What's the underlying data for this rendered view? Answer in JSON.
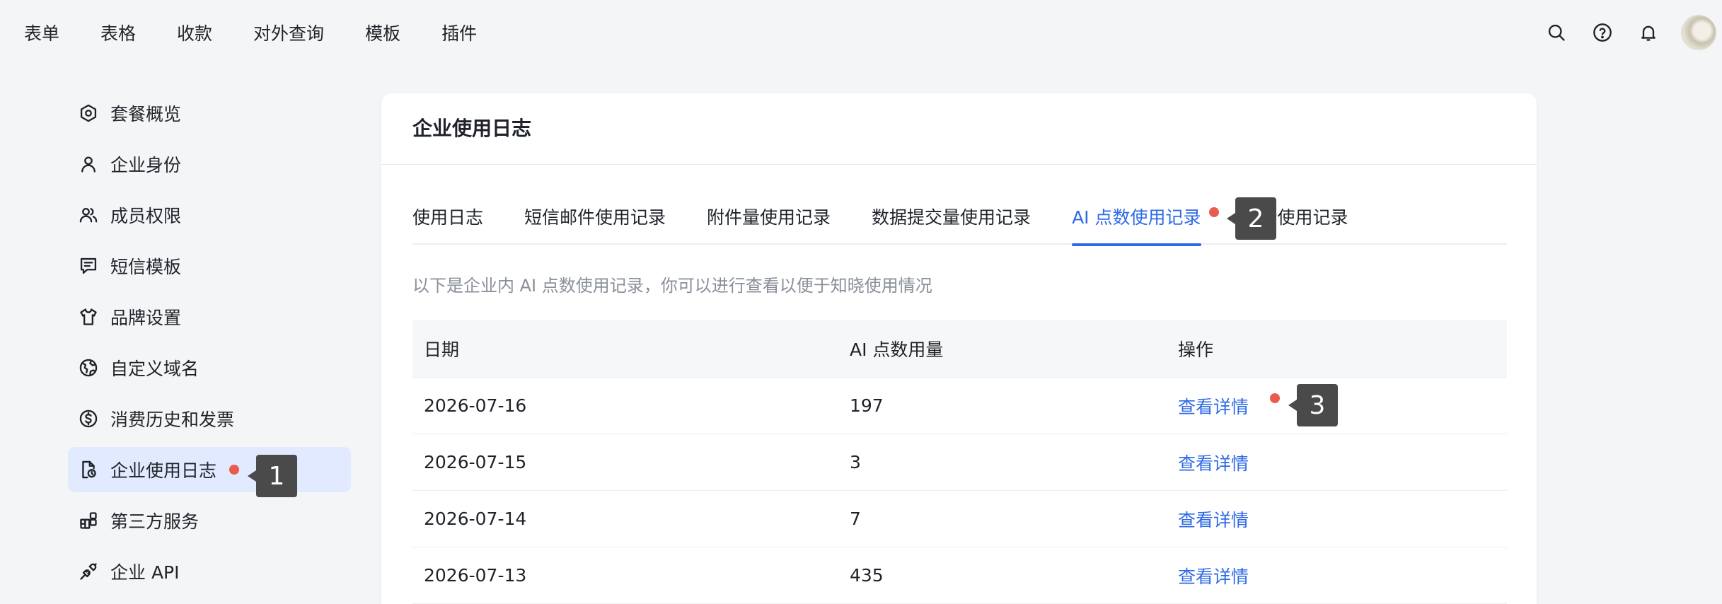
{
  "topnav": {
    "items": [
      "表单",
      "表格",
      "收款",
      "对外查询",
      "模板",
      "插件"
    ],
    "icons": [
      "search-icon",
      "help-icon",
      "bell-icon"
    ]
  },
  "sidebar": {
    "items": [
      {
        "label": "套餐概览",
        "icon": "package-icon"
      },
      {
        "label": "企业身份",
        "icon": "user-icon"
      },
      {
        "label": "成员权限",
        "icon": "users-icon"
      },
      {
        "label": "短信模板",
        "icon": "message-icon"
      },
      {
        "label": "品牌设置",
        "icon": "shirt-icon"
      },
      {
        "label": "自定义域名",
        "icon": "globe-icon"
      },
      {
        "label": "消费历史和发票",
        "icon": "dollar-icon"
      },
      {
        "label": "企业使用日志",
        "icon": "log-icon",
        "active": true
      },
      {
        "label": "第三方服务",
        "icon": "apps-icon"
      },
      {
        "label": "企业 API",
        "icon": "plug-icon"
      }
    ]
  },
  "main": {
    "title": "企业使用日志",
    "tabs": [
      "使用日志",
      "短信邮件使用记录",
      "附件量使用记录",
      "数据提交量使用记录",
      "AI 点数使用记录",
      "语音使用记录"
    ],
    "active_tab": 4,
    "description": "以下是企业内 AI 点数使用记录，你可以进行查看以便于知晓使用情况",
    "table": {
      "headers": [
        "日期",
        "AI 点数用量",
        "操作"
      ],
      "rows": [
        {
          "date": "2026-07-16",
          "amount": "197",
          "action": "查看详情"
        },
        {
          "date": "2026-07-15",
          "amount": "3",
          "action": "查看详情"
        },
        {
          "date": "2026-07-14",
          "amount": "7",
          "action": "查看详情"
        },
        {
          "date": "2026-07-13",
          "amount": "435",
          "action": "查看详情"
        }
      ]
    }
  },
  "annotations": [
    "1",
    "2",
    "3"
  ],
  "colors": {
    "accent": "#2e6ae6",
    "marker": "#ea5b4f",
    "active_bg": "#e1eafe"
  }
}
